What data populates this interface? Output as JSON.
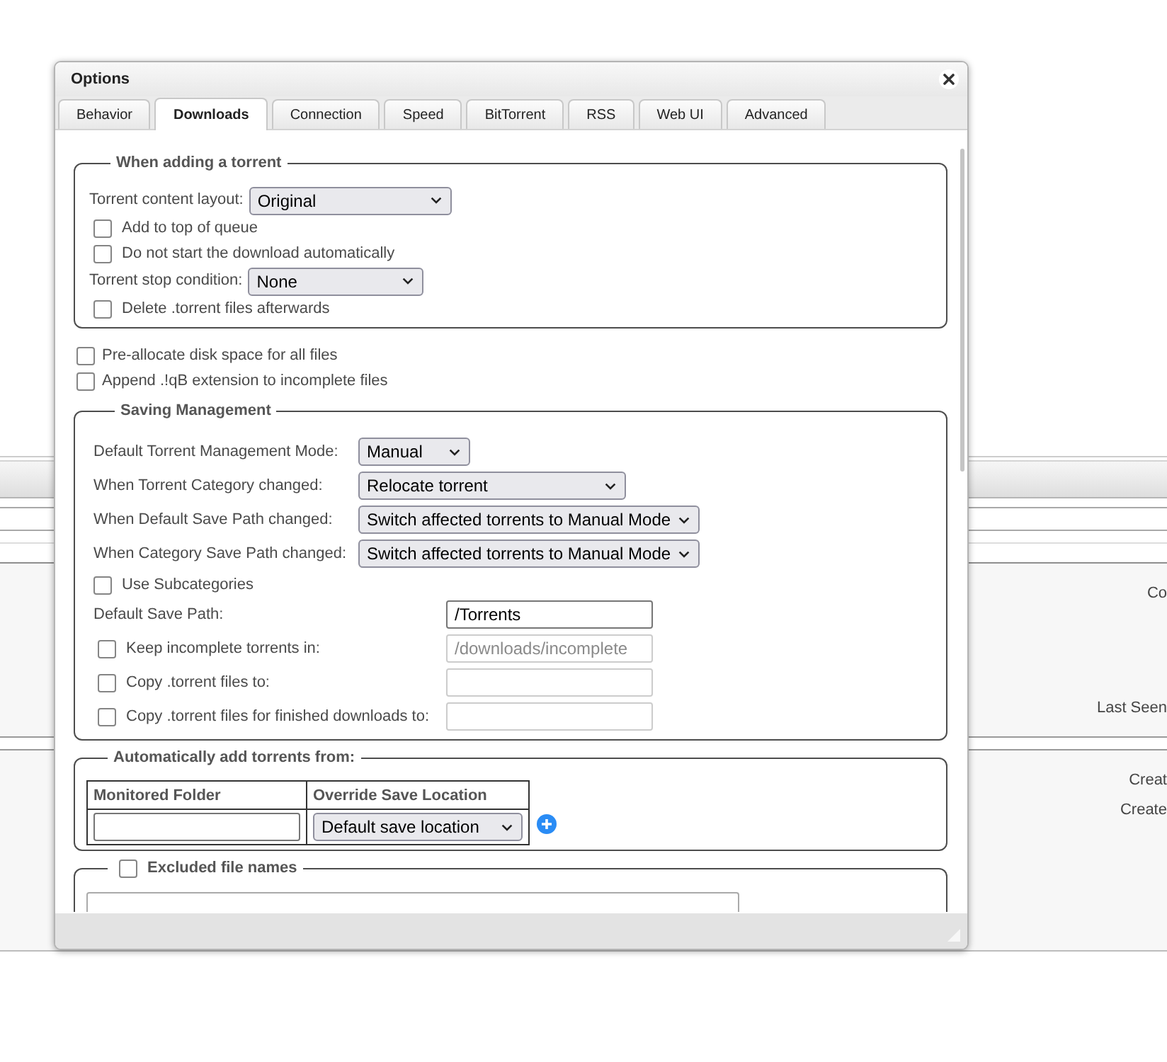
{
  "background": {
    "upper_labels": [
      "Co",
      "Last Seen"
    ],
    "lower_labels": [
      "Creat",
      "Create"
    ]
  },
  "dialog": {
    "title": "Options"
  },
  "tabs": [
    {
      "label": "Behavior",
      "selected": false
    },
    {
      "label": "Downloads",
      "selected": true
    },
    {
      "label": "Connection",
      "selected": false
    },
    {
      "label": "Speed",
      "selected": false
    },
    {
      "label": "BitTorrent",
      "selected": false
    },
    {
      "label": "RSS",
      "selected": false
    },
    {
      "label": "Web UI",
      "selected": false
    },
    {
      "label": "Advanced",
      "selected": false
    }
  ],
  "when_adding": {
    "legend": "When adding a torrent",
    "rows": [
      {
        "kind": "select",
        "label": "Torrent content layout:",
        "value": "Original"
      },
      {
        "kind": "checkbox",
        "label": "Add to top of queue",
        "checked": false
      },
      {
        "kind": "checkbox",
        "label": "Do not start the download automatically",
        "checked": false
      },
      {
        "kind": "select",
        "label": "Torrent stop condition:",
        "value": "None"
      },
      {
        "kind": "checkbox",
        "label": "Delete .torrent files afterwards",
        "checked": false
      }
    ]
  },
  "general_options": [
    {
      "label": "Pre-allocate disk space for all files",
      "checked": false
    },
    {
      "label": "Append .!qB extension to incomplete files",
      "checked": false
    }
  ],
  "saving_management": {
    "legend": "Saving Management",
    "selects": [
      {
        "label": "Default Torrent Management Mode:",
        "value": "Manual"
      },
      {
        "label": "When Torrent Category changed:",
        "value": "Relocate torrent"
      },
      {
        "label": "When Default Save Path changed:",
        "value": "Switch affected torrents to Manual Mode"
      },
      {
        "label": "When Category Save Path changed:",
        "value": "Switch affected torrents to Manual Mode"
      }
    ],
    "subcategories": {
      "label": "Use Subcategories",
      "checked": false
    },
    "paths": [
      {
        "kind": "plain",
        "label": "Default Save Path:",
        "value": "/Torrents",
        "disabled": false
      },
      {
        "kind": "checkbox",
        "label": "Keep incomplete torrents in:",
        "checked": false,
        "value": "/downloads/incomplete",
        "disabled": true
      },
      {
        "kind": "checkbox",
        "label": "Copy .torrent files to:",
        "checked": false,
        "disabled": true
      },
      {
        "kind": "checkbox",
        "label": "Copy .torrent files for finished downloads to:",
        "checked": false,
        "disabled": true
      }
    ]
  },
  "auto_add": {
    "legend": "Automatically add torrents from:",
    "columns": [
      "Monitored Folder",
      "Override Save Location"
    ],
    "rows": [
      {
        "location": "Default save location"
      }
    ]
  },
  "excluded_files": {
    "legend": "Excluded file names",
    "checked": false
  }
}
